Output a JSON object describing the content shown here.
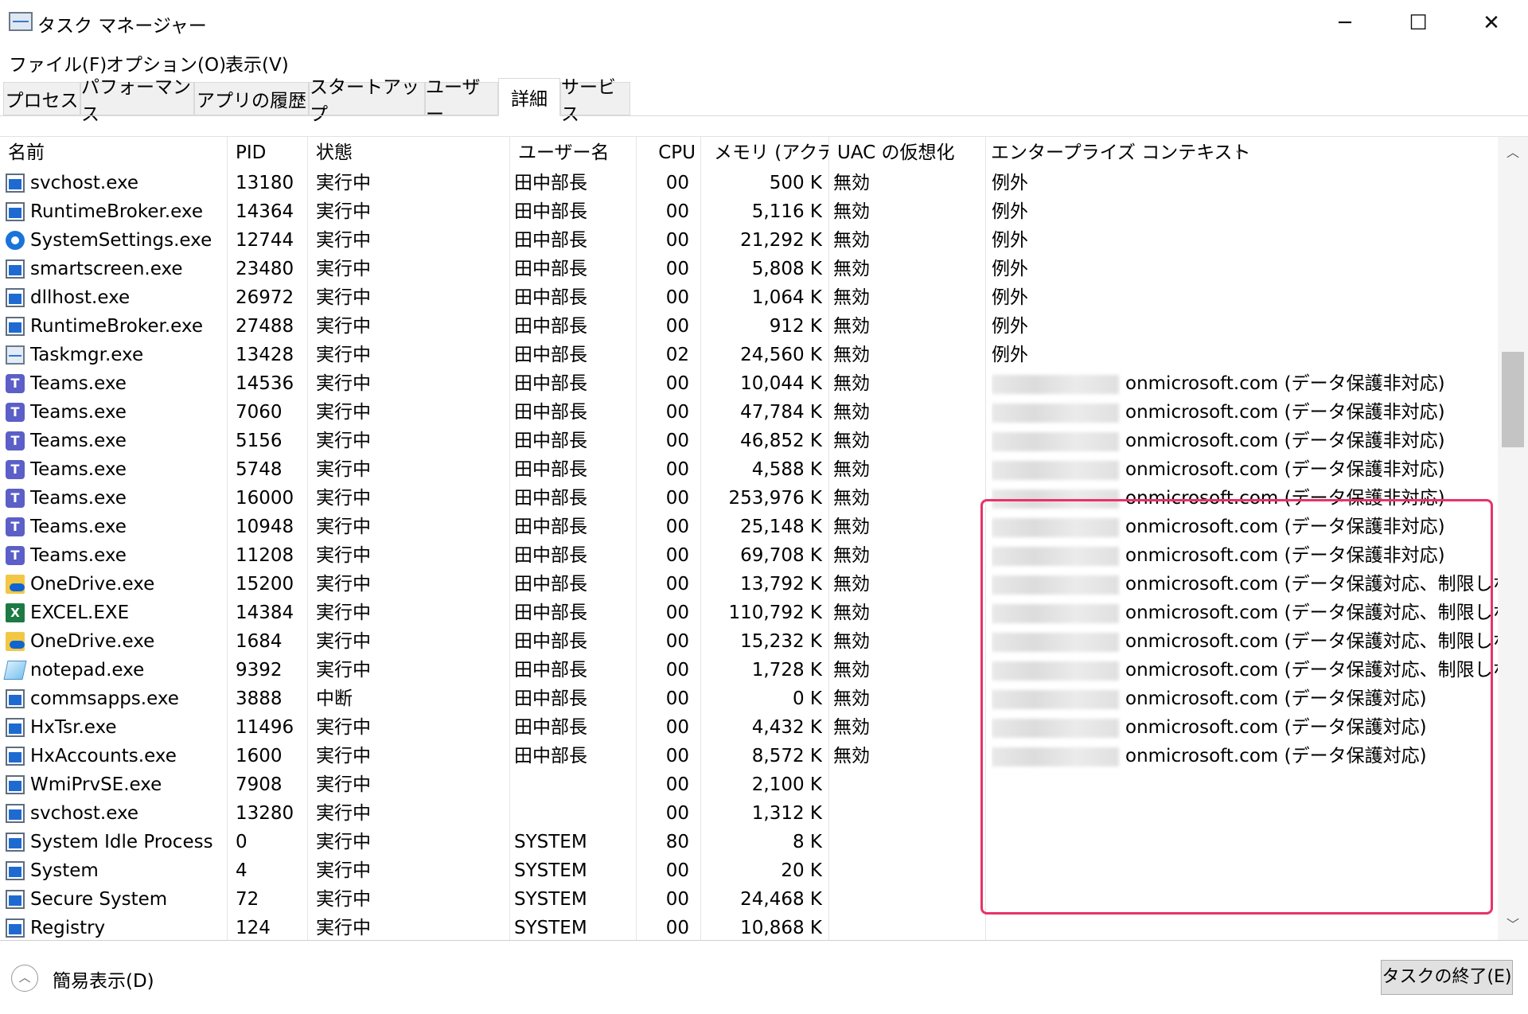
{
  "window": {
    "title": "タスク マネージャー",
    "minimize_icon": "─",
    "maximize_icon": "☐",
    "close_icon": "✕"
  },
  "menu": [
    "ファイル(F)",
    "オプション(O)",
    "表示(V)"
  ],
  "tabs": [
    {
      "label": "プロセス",
      "active": false
    },
    {
      "label": "パフォーマンス",
      "active": false
    },
    {
      "label": "アプリの履歴",
      "active": false
    },
    {
      "label": "スタートアップ",
      "active": false
    },
    {
      "label": "ユーザー",
      "active": false
    },
    {
      "label": "詳細",
      "active": true
    },
    {
      "label": "サービス",
      "active": false
    }
  ],
  "columns": [
    "名前",
    "PID",
    "状態",
    "ユーザー名",
    "CPU",
    "メモリ (アクテ...",
    "UAC の仮想化",
    "エンタープライズ コンテキスト"
  ],
  "sort_icon": "⌄",
  "rows": [
    {
      "icon": "window-icon",
      "name": "svchost.exe",
      "pid": "13180",
      "status": "実行中",
      "user": "田中部長",
      "cpu": "00",
      "mem": "500 K",
      "uac": "無効",
      "enterprise": "例外",
      "blurred": false
    },
    {
      "icon": "window-icon",
      "name": "RuntimeBroker.exe",
      "pid": "14364",
      "status": "実行中",
      "user": "田中部長",
      "cpu": "00",
      "mem": "5,116 K",
      "uac": "無効",
      "enterprise": "例外",
      "blurred": false
    },
    {
      "icon": "gear-icon",
      "name": "SystemSettings.exe",
      "pid": "12744",
      "status": "実行中",
      "user": "田中部長",
      "cpu": "00",
      "mem": "21,292 K",
      "uac": "無効",
      "enterprise": "例外",
      "blurred": false
    },
    {
      "icon": "window-icon",
      "name": "smartscreen.exe",
      "pid": "23480",
      "status": "実行中",
      "user": "田中部長",
      "cpu": "00",
      "mem": "5,808 K",
      "uac": "無効",
      "enterprise": "例外",
      "blurred": false
    },
    {
      "icon": "window-icon",
      "name": "dllhost.exe",
      "pid": "26972",
      "status": "実行中",
      "user": "田中部長",
      "cpu": "00",
      "mem": "1,064 K",
      "uac": "無効",
      "enterprise": "例外",
      "blurred": false
    },
    {
      "icon": "window-icon",
      "name": "RuntimeBroker.exe",
      "pid": "27488",
      "status": "実行中",
      "user": "田中部長",
      "cpu": "00",
      "mem": "912 K",
      "uac": "無効",
      "enterprise": "例外",
      "blurred": false
    },
    {
      "icon": "taskmgr-icon",
      "name": "Taskmgr.exe",
      "pid": "13428",
      "status": "実行中",
      "user": "田中部長",
      "cpu": "02",
      "mem": "24,560 K",
      "uac": "無効",
      "enterprise": "例外",
      "blurred": false
    },
    {
      "icon": "teams-icon",
      "name": "Teams.exe",
      "pid": "14536",
      "status": "実行中",
      "user": "田中部長",
      "cpu": "00",
      "mem": "10,044 K",
      "uac": "無効",
      "enterprise": "onmicrosoft.com (データ保護非対応)",
      "blurred": true
    },
    {
      "icon": "teams-icon",
      "name": "Teams.exe",
      "pid": "7060",
      "status": "実行中",
      "user": "田中部長",
      "cpu": "00",
      "mem": "47,784 K",
      "uac": "無効",
      "enterprise": "onmicrosoft.com (データ保護非対応)",
      "blurred": true
    },
    {
      "icon": "teams-icon",
      "name": "Teams.exe",
      "pid": "5156",
      "status": "実行中",
      "user": "田中部長",
      "cpu": "00",
      "mem": "46,852 K",
      "uac": "無効",
      "enterprise": "onmicrosoft.com (データ保護非対応)",
      "blurred": true
    },
    {
      "icon": "teams-icon",
      "name": "Teams.exe",
      "pid": "5748",
      "status": "実行中",
      "user": "田中部長",
      "cpu": "00",
      "mem": "4,588 K",
      "uac": "無効",
      "enterprise": "onmicrosoft.com (データ保護非対応)",
      "blurred": true
    },
    {
      "icon": "teams-icon",
      "name": "Teams.exe",
      "pid": "16000",
      "status": "実行中",
      "user": "田中部長",
      "cpu": "00",
      "mem": "253,976 K",
      "uac": "無効",
      "enterprise": "onmicrosoft.com (データ保護非対応)",
      "blurred": true
    },
    {
      "icon": "teams-icon",
      "name": "Teams.exe",
      "pid": "10948",
      "status": "実行中",
      "user": "田中部長",
      "cpu": "00",
      "mem": "25,148 K",
      "uac": "無効",
      "enterprise": "onmicrosoft.com (データ保護非対応)",
      "blurred": true
    },
    {
      "icon": "teams-icon",
      "name": "Teams.exe",
      "pid": "11208",
      "status": "実行中",
      "user": "田中部長",
      "cpu": "00",
      "mem": "69,708 K",
      "uac": "無効",
      "enterprise": "onmicrosoft.com (データ保護非対応)",
      "blurred": true
    },
    {
      "icon": "onedrive-icon",
      "name": "OneDrive.exe",
      "pid": "15200",
      "status": "実行中",
      "user": "田中部長",
      "cpu": "00",
      "mem": "13,792 K",
      "uac": "無効",
      "enterprise": "onmicrosoft.com (データ保護対応、制限しない)",
      "blurred": true
    },
    {
      "icon": "excel-icon",
      "name": "EXCEL.EXE",
      "pid": "14384",
      "status": "実行中",
      "user": "田中部長",
      "cpu": "00",
      "mem": "110,792 K",
      "uac": "無効",
      "enterprise": "onmicrosoft.com (データ保護対応、制限しない)",
      "blurred": true
    },
    {
      "icon": "onedrive-icon",
      "name": "OneDrive.exe",
      "pid": "1684",
      "status": "実行中",
      "user": "田中部長",
      "cpu": "00",
      "mem": "15,232 K",
      "uac": "無効",
      "enterprise": "onmicrosoft.com (データ保護対応、制限しない)",
      "blurred": true
    },
    {
      "icon": "notepad-icon",
      "name": "notepad.exe",
      "pid": "9392",
      "status": "実行中",
      "user": "田中部長",
      "cpu": "00",
      "mem": "1,728 K",
      "uac": "無効",
      "enterprise": "onmicrosoft.com (データ保護対応、制限しない)",
      "blurred": true
    },
    {
      "icon": "window-icon",
      "name": "commsapps.exe",
      "pid": "3888",
      "status": "中断",
      "user": "田中部長",
      "cpu": "00",
      "mem": "0 K",
      "uac": "無効",
      "enterprise": "onmicrosoft.com (データ保護対応)",
      "blurred": true
    },
    {
      "icon": "window-icon",
      "name": "HxTsr.exe",
      "pid": "11496",
      "status": "実行中",
      "user": "田中部長",
      "cpu": "00",
      "mem": "4,432 K",
      "uac": "無効",
      "enterprise": "onmicrosoft.com (データ保護対応)",
      "blurred": true
    },
    {
      "icon": "window-icon",
      "name": "HxAccounts.exe",
      "pid": "1600",
      "status": "実行中",
      "user": "田中部長",
      "cpu": "00",
      "mem": "8,572 K",
      "uac": "無効",
      "enterprise": "onmicrosoft.com (データ保護対応)",
      "blurred": true
    },
    {
      "icon": "window-icon",
      "name": "WmiPrvSE.exe",
      "pid": "7908",
      "status": "実行中",
      "user": "",
      "cpu": "00",
      "mem": "2,100 K",
      "uac": "",
      "enterprise": "",
      "blurred": false
    },
    {
      "icon": "window-icon",
      "name": "svchost.exe",
      "pid": "13280",
      "status": "実行中",
      "user": "",
      "cpu": "00",
      "mem": "1,312 K",
      "uac": "",
      "enterprise": "",
      "blurred": false
    },
    {
      "icon": "window-icon",
      "name": "System Idle Process",
      "pid": "0",
      "status": "実行中",
      "user": "SYSTEM",
      "cpu": "80",
      "mem": "8 K",
      "uac": "",
      "enterprise": "",
      "blurred": false
    },
    {
      "icon": "window-icon",
      "name": "System",
      "pid": "4",
      "status": "実行中",
      "user": "SYSTEM",
      "cpu": "00",
      "mem": "20 K",
      "uac": "",
      "enterprise": "",
      "blurred": false
    },
    {
      "icon": "window-icon",
      "name": "Secure System",
      "pid": "72",
      "status": "実行中",
      "user": "SYSTEM",
      "cpu": "00",
      "mem": "24,468 K",
      "uac": "",
      "enterprise": "",
      "blurred": false
    },
    {
      "icon": "window-icon",
      "name": "Registry",
      "pid": "124",
      "status": "実行中",
      "user": "SYSTEM",
      "cpu": "00",
      "mem": "10,868 K",
      "uac": "",
      "enterprise": "",
      "blurred": false
    }
  ],
  "highlight_color": "#e8336a",
  "scrollbar": {
    "up_icon": "︿",
    "down_icon": "﹀"
  },
  "footer": {
    "collapse_icon": "︿",
    "collapse_label": "簡易表示(D)",
    "end_task_label": "タスクの終了(E)"
  }
}
